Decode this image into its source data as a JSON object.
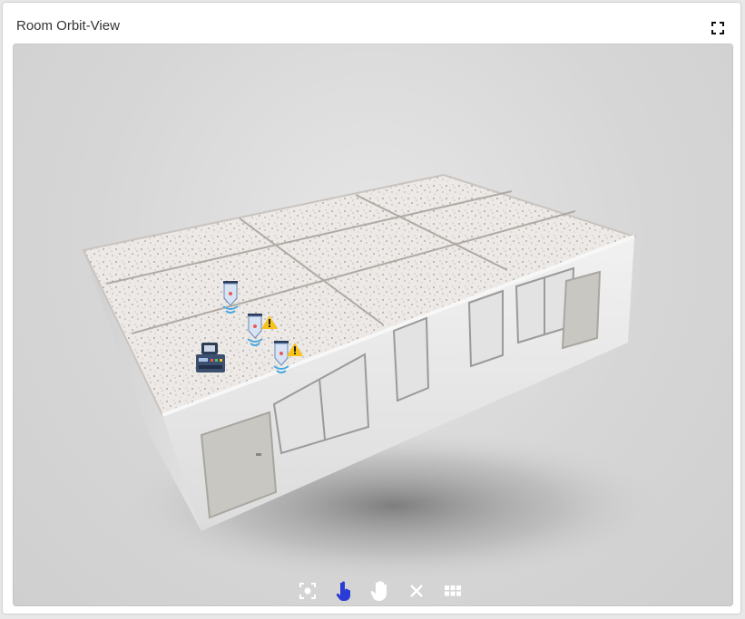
{
  "window": {
    "title": "Room Orbit-View"
  },
  "header": {
    "fullscreen_icon": "fullscreen-icon"
  },
  "scene": {
    "objects": [
      {
        "name": "sensor-1",
        "icon": "wireless-sensor-icon",
        "warning": false
      },
      {
        "name": "sensor-2",
        "icon": "wireless-sensor-icon",
        "warning": true
      },
      {
        "name": "sensor-3",
        "icon": "wireless-sensor-icon",
        "warning": true
      },
      {
        "name": "gateway",
        "icon": "gateway-device-icon",
        "warning": false
      }
    ]
  },
  "toolbar": {
    "tools": [
      {
        "name": "focus",
        "icon": "focus-icon",
        "active": false
      },
      {
        "name": "select",
        "icon": "pointer-hand-icon",
        "active": true
      },
      {
        "name": "pan",
        "icon": "hand-icon",
        "active": false
      },
      {
        "name": "close",
        "icon": "close-icon",
        "active": false
      },
      {
        "name": "grid",
        "icon": "grid-icon",
        "active": false
      }
    ],
    "active_color": "#2a3bd6",
    "icon_color": "#ffffff"
  }
}
